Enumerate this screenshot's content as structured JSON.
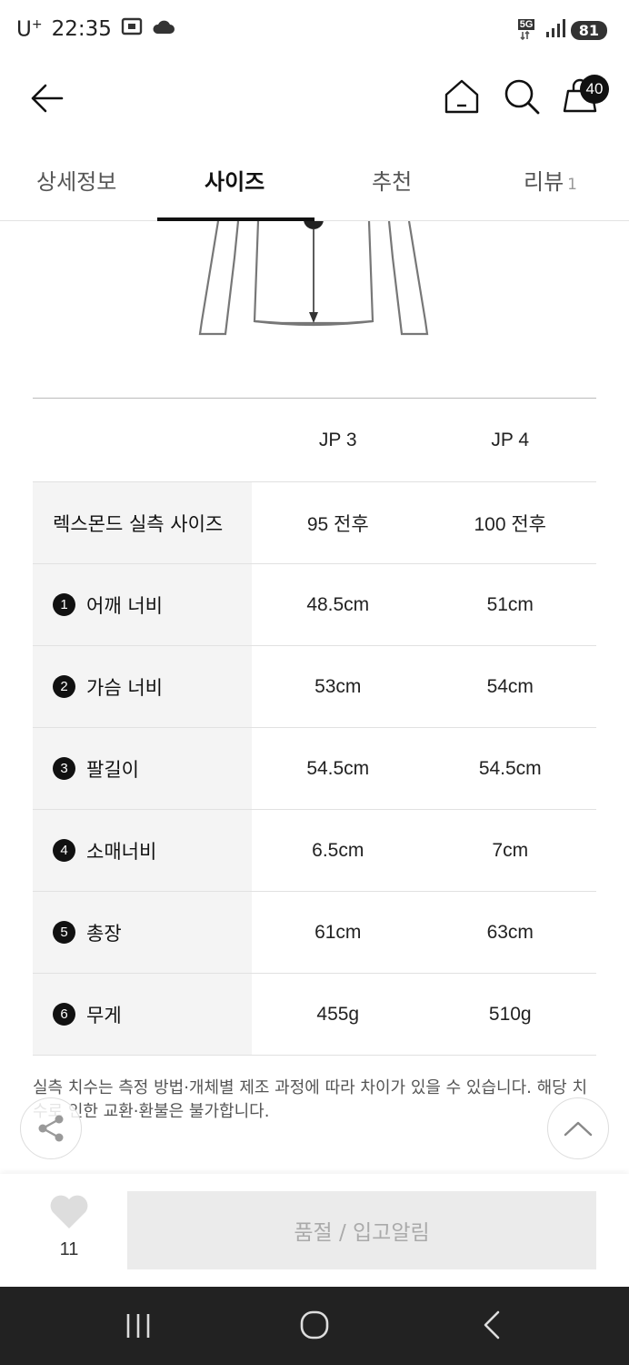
{
  "status_bar": {
    "carrier": "U",
    "carrier_sup": "+",
    "time": "22:35",
    "network": "5G",
    "battery": "81"
  },
  "header": {
    "cart_count": "40"
  },
  "tabs": [
    {
      "label": "상세정보",
      "active": false
    },
    {
      "label": "사이즈",
      "active": true
    },
    {
      "label": "추천",
      "active": false
    },
    {
      "label": "리뷰",
      "count": "1",
      "active": false
    }
  ],
  "size_table": {
    "columns": [
      "JP 3",
      "JP 4"
    ],
    "rows": [
      {
        "num": "",
        "label": "렉스몬드 실측 사이즈",
        "values": [
          "95 전후",
          "100 전후"
        ]
      },
      {
        "num": "1",
        "label": "어깨 너비",
        "values": [
          "48.5cm",
          "51cm"
        ]
      },
      {
        "num": "2",
        "label": "가슴 너비",
        "values": [
          "53cm",
          "54cm"
        ]
      },
      {
        "num": "3",
        "label": "팔길이",
        "values": [
          "54.5cm",
          "54.5cm"
        ]
      },
      {
        "num": "4",
        "label": "소매너비",
        "values": [
          "6.5cm",
          "7cm"
        ]
      },
      {
        "num": "5",
        "label": "총장",
        "values": [
          "61cm",
          "63cm"
        ]
      },
      {
        "num": "6",
        "label": "무게",
        "values": [
          "455g",
          "510g"
        ]
      }
    ]
  },
  "note": "실측 치수는 측정 방법·개체별 제조 과정에 따라 차이가 있을 수 있습니다. 해당 치수로 인한 교환·환불은 불가합니다.",
  "bottom_bar": {
    "like_count": "11",
    "soldout_label": "품절 / 입고알림"
  }
}
